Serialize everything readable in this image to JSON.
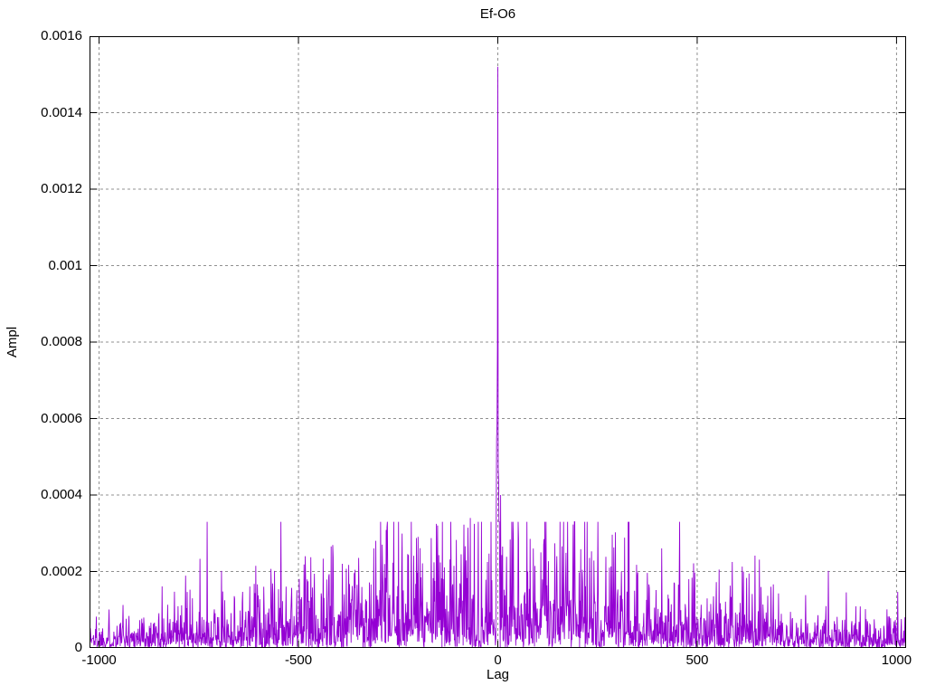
{
  "figure": {
    "background": "#ffffff",
    "frame_color": "#000000"
  },
  "chart_data": {
    "type": "line",
    "title": "Ef-O6",
    "xlabel": "Lag",
    "ylabel": "Ampl",
    "description": "Noisy cross-correlation amplitude versus lag with a single sharp peak at lag 0",
    "xlim": [
      -1024,
      1024
    ],
    "ylim": [
      0,
      0.0016
    ],
    "grid": true,
    "legend": "none",
    "line_color": "#9400d3",
    "grid_color": "#909090",
    "tick_color": "#000000",
    "xticks": [
      {
        "value": -1000,
        "label": "-1000"
      },
      {
        "value": -500,
        "label": "-500"
      },
      {
        "value": 0,
        "label": "0"
      },
      {
        "value": 500,
        "label": "500"
      },
      {
        "value": 1000,
        "label": "1000"
      }
    ],
    "yticks": [
      {
        "value": 0.0,
        "label": "0"
      },
      {
        "value": 0.0002,
        "label": "0.0002"
      },
      {
        "value": 0.0004,
        "label": "0.0004"
      },
      {
        "value": 0.0006,
        "label": "0.0006"
      },
      {
        "value": 0.0008,
        "label": "0.0008"
      },
      {
        "value": 0.001,
        "label": "0.001"
      },
      {
        "value": 0.0012,
        "label": "0.0012"
      },
      {
        "value": 0.0014,
        "label": "0.0014"
      },
      {
        "value": 0.0016,
        "label": "0.0016"
      }
    ],
    "peak": {
      "lag": 0,
      "ampl": 0.00152
    },
    "notable_points": [
      {
        "lag": -4,
        "ampl": 0.00035
      },
      {
        "lag": -3,
        "ampl": 0.00055
      },
      {
        "lag": -2,
        "ampl": 0.00058
      },
      {
        "lag": -1,
        "ampl": 0.00078
      },
      {
        "lag": 1,
        "ampl": 0.00047
      },
      {
        "lag": 2,
        "ampl": 0.00044
      },
      {
        "lag": 4,
        "ampl": 0.00033
      },
      {
        "lag": 7,
        "ampl": 0.0004
      },
      {
        "lag": -69,
        "ampl": 0.00034
      },
      {
        "lag": -75,
        "ampl": 0.0003
      },
      {
        "lag": -290,
        "ampl": 0.00027
      },
      {
        "lag": -390,
        "ampl": 0.00022
      },
      {
        "lag": -483,
        "ampl": 0.00024
      },
      {
        "lag": -587,
        "ampl": 0.00016
      },
      {
        "lag": -766,
        "ampl": 0.00013
      },
      {
        "lag": 89,
        "ampl": 0.00026
      },
      {
        "lag": 148,
        "ampl": 0.00024
      },
      {
        "lag": 280,
        "ampl": 0.00021
      },
      {
        "lag": 310,
        "ampl": 0.0002
      },
      {
        "lag": 455,
        "ampl": 0.00019
      },
      {
        "lag": 685,
        "ampl": 0.00016
      }
    ],
    "noise_model": {
      "distribution": "exponential",
      "base": 2.8e-05,
      "amp": 8e-05,
      "gaussian_width_lags": 560,
      "clip": 0.00033,
      "lag_step": 1,
      "seed": 1337
    }
  }
}
